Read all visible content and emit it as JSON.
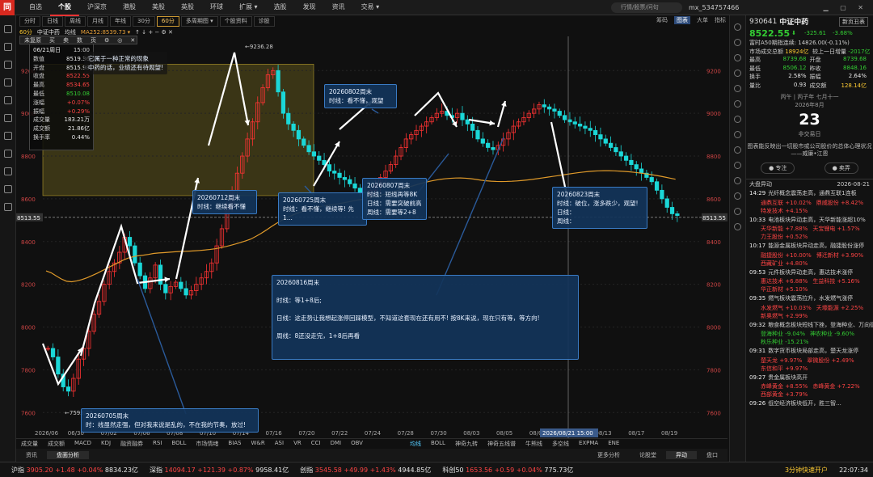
{
  "top_nav": {
    "logo": "同花",
    "items": [
      "自选",
      "个股",
      "沪深京",
      "港股",
      "美股",
      "英股",
      "环球",
      "扩展 ▾",
      "选股",
      "发现",
      "资讯",
      "交易 ▾"
    ],
    "active": 1,
    "search_placeholder": "行情/股票/问句",
    "user": "mx_534757466",
    "win": "▁ ▢ ✕"
  },
  "period_tabs": [
    "分时",
    "日线",
    "周线",
    "月线",
    "年线",
    "30分",
    "60分",
    "多周期图 ▾",
    "个股资料",
    "诊股"
  ],
  "period_active": 6,
  "right_tabs": [
    "筹码",
    "图表",
    "大单",
    "指标"
  ],
  "right_tab_active": 1,
  "indicator_bar": {
    "period": "60分",
    "name": "中证中药",
    "ma_label": "均线",
    "ma": "MA252:8539.73 ▾",
    "icons": "↑ ↓ + − ⚙ ✕"
  },
  "context_menu": [
    "未复原",
    "买",
    "卖",
    "数",
    "页",
    "⚙",
    "◎",
    "✕"
  ],
  "info_box": {
    "date": "06/21周日",
    "time": "15:00",
    "rows": [
      [
        "数值",
        "8519.36"
      ],
      [
        "开盘",
        "8515.98"
      ],
      [
        "收盘",
        "8522.55"
      ],
      [
        "最高",
        "8534.65"
      ],
      [
        "最低",
        "8510.08"
      ],
      [
        "涨幅",
        "+0.07%"
      ],
      [
        "振幅",
        "+0.29%"
      ],
      [
        "成交量",
        "183.21万"
      ],
      [
        "成交额",
        "21.86亿"
      ],
      [
        "换手率",
        "0.44%"
      ]
    ],
    "comment": "它属于一种正常的现象\n中药的话，业绩还有待观望!"
  },
  "current_price_label": "8513.55",
  "cursor_time": "2026/08/21 15:00",
  "high_label": "9236.28",
  "low_label": "7593.73",
  "y_ticks": [
    9200,
    9000,
    8800,
    8600,
    8400,
    8200,
    8000,
    7800,
    7600
  ],
  "x_ticks": [
    "2026/06",
    "06/30",
    "07/02",
    "07/06",
    "07/08",
    "07/10",
    "07/14",
    "07/16",
    "07/20",
    "07/22",
    "07/24",
    "07/28",
    "07/30",
    "08/03",
    "08/05",
    "08/07",
    "08/11",
    "08/13",
    "08/17",
    "08/19"
  ],
  "notes": [
    {
      "id": "n0705",
      "text": "20260705周末\n时：线虽然走强，但对我来说是乱的，不在我的节奏，放过!"
    },
    {
      "id": "n0712",
      "text": "20260712周末\n时线：继续看不懂"
    },
    {
      "id": "n0725",
      "text": "20260725周末\n时线：看不懂，继续等! 先1..."
    },
    {
      "id": "n0802",
      "text": "20260802周末\n时线：看不懂，观望"
    },
    {
      "id": "n0807",
      "text": "20260807周末\n时线：短线再等8K\n日线：需要突破前高\n周线：需要等2+8"
    },
    {
      "id": "n0816",
      "text": "20260816周末\n\n时线：等1+8后;\n\n日线：这走势让我想起涨停回踩模型，不知道这套现在还有用不! 按8K来说，现在只有等，等方向!\n\n周线：8还没走完，1+8后再看"
    },
    {
      "id": "n0823",
      "text": "20260823周末\n时线：破位，涨多跌少，观望!\n日线：\n周线："
    }
  ],
  "sub_indicators": [
    "成交量",
    "成交额",
    "MACD",
    "KDJ",
    "融资融券",
    "RSI",
    "BOLL",
    "市场情绪",
    "BIAS",
    "W&R",
    "ASI",
    "VR",
    "CCI",
    "DMI",
    "OBV"
  ],
  "sub_indicators2": [
    "均线",
    "BOLL",
    "神奇九转",
    "神奇五线谱",
    "牛熊线",
    "多空线",
    "EXPMA",
    "ENE"
  ],
  "bottom_tabs": [
    "资讯",
    "盘面分析"
  ],
  "bottom_active": 1,
  "bottom_right": [
    "更多分析",
    "论股堂",
    "异动",
    "盘口"
  ],
  "status": {
    "indices": [
      {
        "name": "沪指",
        "val": "3905.20",
        "chg": "+1.48",
        "pct": "+0.04%",
        "amt": "8834.23亿"
      },
      {
        "name": "深指",
        "val": "14094.17",
        "chg": "+121.39",
        "pct": "+0.87%",
        "amt": "9958.41亿"
      },
      {
        "name": "创指",
        "val": "3545.58",
        "chg": "+49.99",
        "pct": "+1.43%",
        "amt": "4944.85亿"
      },
      {
        "name": "科创50",
        "val": "1653.56",
        "chg": "+0.59",
        "pct": "+0.04%",
        "amt": "775.73亿"
      }
    ],
    "notice": "3分钟快速开户",
    "time": "22:07:34"
  },
  "quote": {
    "code": "930641",
    "name": "中证中药",
    "btn": "新页丑表",
    "price": "8522.55",
    "arrow": "⬇",
    "chg": "-325.61",
    "pct": "-3.68%",
    "line1": "富时A50期指连续: 14826.00(-0.11%)",
    "line2": [
      "市场成交总额",
      "18924亿",
      "较上一日增量",
      "-2017亿"
    ],
    "rows": [
      [
        "最高",
        "8739.68",
        "开盘",
        "8739.68"
      ],
      [
        "最低",
        "8506.12",
        "昨收",
        "8848.16"
      ],
      [
        "换手",
        "2.58%",
        "振幅",
        "2.64%"
      ],
      [
        "量比",
        "0.93",
        "成交额",
        "128.14亿"
      ]
    ]
  },
  "calendar": {
    "weekday": "丙午 | 丙子年 七月十一",
    "month": "2026年8月",
    "day": "23",
    "sub": "非交易日",
    "quote": "图表能反映出一切股市或公司股价的总体心理状况\n——威廉•江恩",
    "follow": "● 专注",
    "buy": "● 卖弄"
  },
  "news": {
    "title": "大盘异动",
    "date": "2026-08-21",
    "items": [
      {
        "t": "14:29",
        "txt": "光纤概念震荡走高，通鼎互联1连板",
        "s": [
          [
            "通鼎互联",
            "+10.02%"
          ],
          [
            "鼎威股份",
            "+8.42%"
          ],
          [
            "特发技术",
            "+4.15%"
          ]
        ]
      },
      {
        "t": "10:33",
        "txt": "电池板块异动走高，天华新能涨超10%",
        "s": [
          [
            "天华新能",
            "+7.88%"
          ],
          [
            "天宝锂电",
            "+1.57%"
          ],
          [
            "力王股份",
            "+0.52%"
          ]
        ]
      },
      {
        "t": "10:17",
        "txt": "能源金属板块异动走高，融捷股份涨停",
        "s": [
          [
            "融捷股份",
            "+10.00%"
          ],
          [
            "博迁新材",
            "+3.90%"
          ],
          [
            "西藏矿业",
            "+4.80%"
          ]
        ]
      },
      {
        "t": "09:53",
        "txt": "元件板块异动走高，惠达技术涨停",
        "s": [
          [
            "惠达技术",
            "+6.88%"
          ],
          [
            "生益科技",
            "+5.16%"
          ],
          [
            "华正新材",
            "+5.10%"
          ]
        ]
      },
      {
        "t": "09:35",
        "txt": "燃气板块震荡拉升，水发燃气涨停",
        "s": [
          [
            "水发燃气",
            "+10.03%"
          ],
          [
            "天壕能源",
            "+2.25%"
          ],
          [
            "新奥燃气",
            "+2.99%"
          ]
        ]
      },
      {
        "t": "09:32",
        "txt": "粮食概念板块短线下挫，登海种业、万向德农",
        "s": [
          [
            "登海种业",
            "-9.04%"
          ],
          [
            "神农种业",
            "-9.60%"
          ],
          [
            "秋乐种业",
            "-15.21%"
          ]
        ]
      },
      {
        "t": "09:31",
        "txt": "数字货币板块局部走高，楚天龙涨停",
        "s": [
          [
            "楚天龙",
            "+9.97%"
          ],
          [
            "翠微股份",
            "+2.49%"
          ],
          [
            "东信和平",
            "+9.97%"
          ]
        ]
      },
      {
        "t": "09:27",
        "txt": "贵金属板块高开",
        "s": [
          [
            "赤峰黄金",
            "+8.55%"
          ],
          [
            "赤峰黄金",
            "+7.22%"
          ],
          [
            "西部黄金",
            "+3.79%"
          ]
        ]
      },
      {
        "t": "09:26",
        "txt": "低空经济板块低开，胜三智...",
        "s": []
      }
    ]
  },
  "chart_data": {
    "type": "candlestick",
    "y_range": [
      7480,
      9360
    ],
    "price_line": 8513.55,
    "ma_label": "MA252",
    "zone": {
      "y_top": 9230,
      "y_bottom": 8615
    },
    "closes": [
      7900,
      7860,
      7780,
      7720,
      7700,
      7760,
      7850,
      7900,
      7980,
      8060,
      8120,
      8200,
      8260,
      8300,
      8350,
      8420,
      8380,
      8300,
      8240,
      8180,
      8230,
      8290,
      8200,
      8160,
      8190,
      8210,
      8180,
      8150,
      8170,
      8200,
      8230,
      8260,
      8300,
      8380,
      8460,
      8560,
      8640,
      8720,
      8800,
      8880,
      8960,
      9050,
      9120,
      9180,
      9200,
      9100,
      9000,
      8950,
      8920,
      8880,
      8850,
      8820,
      8800,
      8780,
      8760,
      8730,
      8720,
      8700,
      8690,
      8670,
      8650,
      8630,
      8620,
      8640,
      8660,
      8700,
      8730,
      8760,
      8800,
      8840,
      8880,
      8900,
      8920,
      8940,
      8960,
      8980,
      9000,
      9010,
      8990,
      8980,
      9000,
      8970,
      8950,
      8920,
      8880,
      8860,
      8840,
      8830,
      8850,
      8880,
      8910,
      8940,
      8960,
      8980,
      9000,
      9020,
      9040,
      9030,
      9020,
      9010,
      8990,
      8970,
      8960,
      8950,
      8940,
      8930,
      8920,
      8900,
      8880,
      8860,
      8840,
      8820,
      8800,
      8780,
      8760,
      8740,
      8720,
      8700,
      8680,
      8640,
      8600,
      8560,
      8530,
      8522
    ]
  }
}
